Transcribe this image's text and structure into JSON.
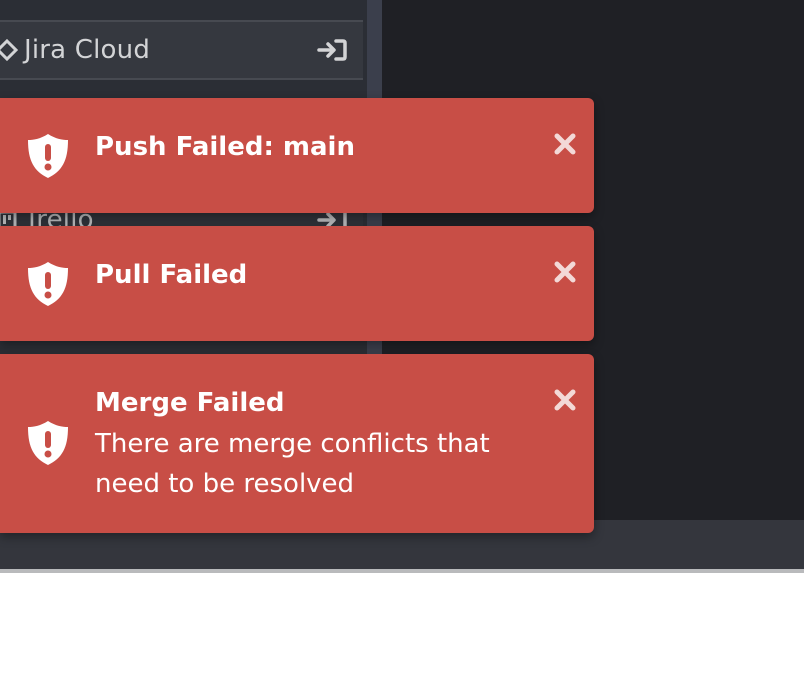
{
  "sidebar": {
    "integrations": [
      {
        "label": "Jira Cloud",
        "icon": "diamond-icon",
        "action_icon": "sign-in-icon"
      },
      {
        "label": "Trello",
        "icon": "trello-icon",
        "action_icon": "sign-in-icon"
      }
    ]
  },
  "toasts": [
    {
      "title": "Push Failed: main",
      "message": "",
      "icon": "shield-exclamation-icon",
      "close_icon": "close-icon"
    },
    {
      "title": "Pull Failed",
      "message": "",
      "icon": "shield-exclamation-icon",
      "close_icon": "close-icon"
    },
    {
      "title": "Merge Failed",
      "message": "There are merge conflicts that need to be resolved",
      "icon": "shield-exclamation-icon",
      "close_icon": "close-icon"
    }
  ],
  "colors": {
    "toast_bg": "#c84e46",
    "app_bg": "#1f2025",
    "sidebar_bg": "#2b2e35",
    "text_light": "#d3d4d6"
  }
}
